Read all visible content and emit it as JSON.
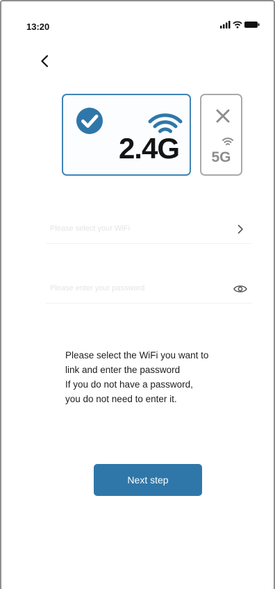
{
  "status_bar": {
    "time": "13:20"
  },
  "bands": {
    "band_24": {
      "label": "2.4G",
      "selected": true
    },
    "band_5": {
      "label": "5G",
      "selected": false
    }
  },
  "form": {
    "wifi_placeholder": "Please select your WiFi",
    "password_placeholder": "Please enter your password"
  },
  "instructions": {
    "line1": "Please select the WiFi you want to",
    "line2": "link and enter the password",
    "line3": "If you do not have a password,",
    "line4": "you do not need to enter it."
  },
  "actions": {
    "next_label": "Next step"
  },
  "colors": {
    "accent": "#2f77a9",
    "selected_border": "#3f84b5",
    "disabled": "#8d8d8d"
  },
  "icons": {
    "back": "chevron-left-icon",
    "check": "check-circle-icon",
    "wifi": "wifi-icon",
    "cross": "close-icon",
    "select_arrow": "chevron-right-icon",
    "password_toggle": "eye-icon"
  }
}
